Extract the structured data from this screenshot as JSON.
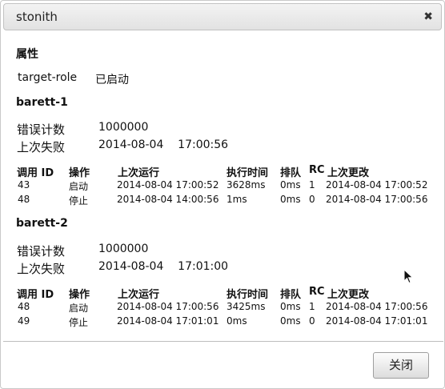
{
  "dialog": {
    "title": "stonith",
    "close_icon": "✖",
    "close_button_label": "关闭"
  },
  "properties": {
    "heading": "属性",
    "items": [
      {
        "key": "target-role",
        "value": "已启动"
      }
    ]
  },
  "table_headers": [
    "调用 ID",
    "操作",
    "上次运行",
    "执行时间",
    "排队",
    "RC",
    "上次更改"
  ],
  "nodes": [
    {
      "name": "barett-1",
      "fail_count_label": "错误计数",
      "fail_count": "1000000",
      "last_failure_label": "上次失败",
      "last_failure": "2014-08-04    17:00:56",
      "rows": [
        {
          "call_id": "43",
          "op": "启动",
          "last_run": "2014-08-04 17:00:52",
          "exec_time": "3628ms",
          "queue": "0ms",
          "rc": "1",
          "last_change": "2014-08-04 17:00:52"
        },
        {
          "call_id": "48",
          "op": "停止",
          "last_run": "2014-08-04 14:00:56",
          "exec_time": "1ms",
          "queue": "0ms",
          "rc": "0",
          "last_change": "2014-08-04 17:00:56"
        }
      ]
    },
    {
      "name": "barett-2",
      "fail_count_label": "错误计数",
      "fail_count": "1000000",
      "last_failure_label": "上次失败",
      "last_failure": "2014-08-04    17:01:00",
      "rows": [
        {
          "call_id": "48",
          "op": "启动",
          "last_run": "2014-08-04 17:00:56",
          "exec_time": "3425ms",
          "queue": "0ms",
          "rc": "1",
          "last_change": "2014-08-04 17:00:56"
        },
        {
          "call_id": "49",
          "op": "停止",
          "last_run": "2014-08-04 17:01:01",
          "exec_time": "0ms",
          "queue": "0ms",
          "rc": "0",
          "last_change": "2014-08-04 17:01:01"
        }
      ]
    }
  ]
}
